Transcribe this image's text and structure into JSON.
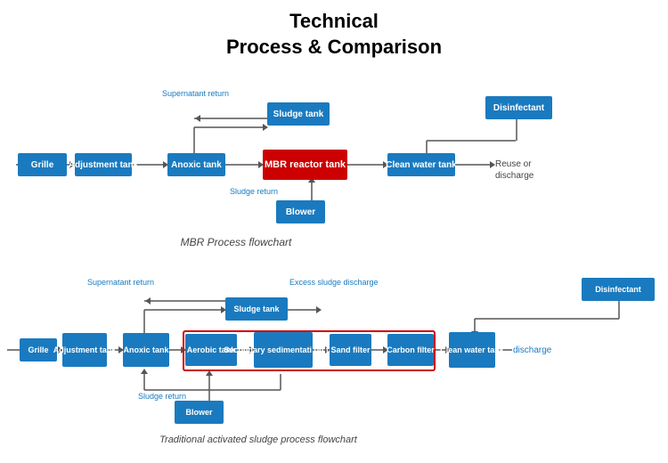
{
  "title": {
    "line1": "Technical",
    "line2": "Process & Comparison"
  },
  "diagram1": {
    "label": "MBR Process flowchart",
    "boxes": {
      "grille": "Grille",
      "adjustment_tank": "Adjustment tank",
      "anoxic_tank": "Anoxic tank",
      "mbr_reactor": "MBR reactor  tank",
      "clean_water_tank": "Clean water tank",
      "sludge_tank": "Sludge tank",
      "blower": "Blower",
      "disinfectant": "Disinfectant"
    },
    "labels": {
      "supernatant_return": "Supernatant return",
      "sludge_return": "Sludge return",
      "reuse_or_discharge": "Reuse or\ndischarge"
    }
  },
  "diagram2": {
    "label": "Traditional activated sludge process flowchart",
    "boxes": {
      "grille": "Grille",
      "adjustment_tank": "Adjustment\ntank",
      "anoxic_tank": "Anoxic\ntank",
      "aerobic_tank": "Aerobic\ntank",
      "secondary_sed": "Secondary\nsedimentati\non tank",
      "sand_filter": "Sand\nfilter",
      "carbon_filter": "Carbon\nfilter",
      "clean_water_tank": "Clean\nwater\ntank",
      "sludge_tank": "Sludge tank",
      "blower": "Blower",
      "disinfectant": "Disinfectant"
    },
    "labels": {
      "supernatant_return": "Supernatant return",
      "sludge_return": "Sludge return",
      "excess_sludge": "Excess sludge discharge",
      "discharge": "discharge"
    }
  },
  "colors": {
    "blue": "#1a7abf",
    "red": "#cc0000",
    "arrow": "#555555",
    "label_blue": "#1a7abf"
  }
}
